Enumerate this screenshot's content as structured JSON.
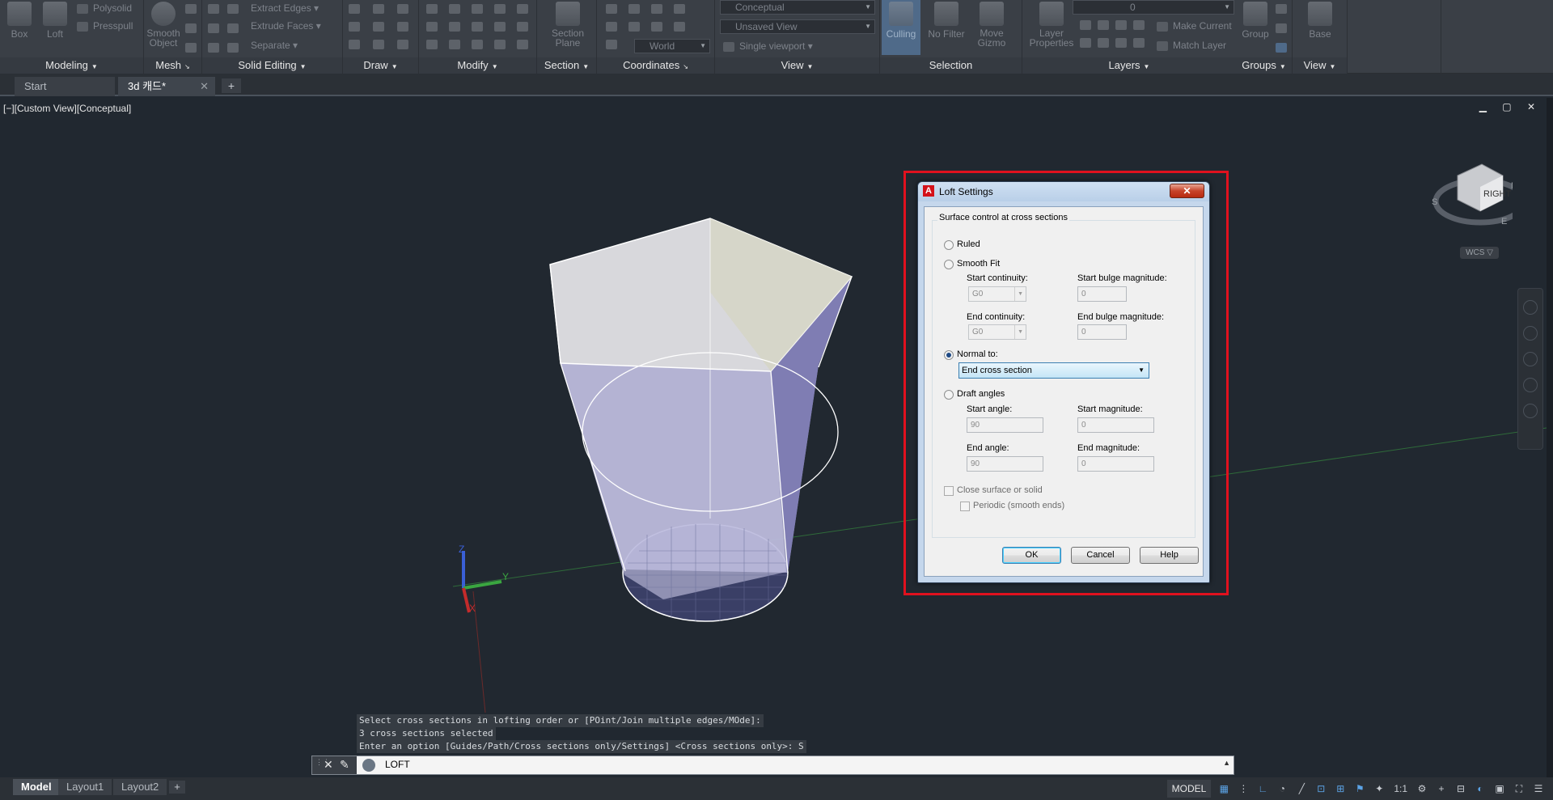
{
  "ribbon": {
    "panels": [
      {
        "key": "modeling",
        "title": "Modeling"
      },
      {
        "key": "mesh",
        "title": "Mesh"
      },
      {
        "key": "solid_editing",
        "title": "Solid Editing"
      },
      {
        "key": "draw",
        "title": "Draw"
      },
      {
        "key": "modify",
        "title": "Modify"
      },
      {
        "key": "section",
        "title": "Section"
      },
      {
        "key": "coordinates",
        "title": "Coordinates"
      },
      {
        "key": "view",
        "title": "View"
      },
      {
        "key": "selection",
        "title": "Selection"
      },
      {
        "key": "layers",
        "title": "Layers"
      },
      {
        "key": "groups",
        "title": "Groups"
      },
      {
        "key": "view2",
        "title": "View"
      }
    ],
    "modeling": {
      "box": "Box",
      "loft": "Loft",
      "polysolid": "Polysolid",
      "presspull": "Presspull"
    },
    "mesh": {
      "smooth_object": "Smooth\nObject"
    },
    "solid_editing": {
      "extract_edges": "Extract Edges",
      "extrude_faces": "Extrude Faces",
      "separate": "Separate"
    },
    "section": {
      "section_plane": "Section\nPlane"
    },
    "coordinates": {
      "world": "World"
    },
    "view": {
      "visual_style": "Conceptual",
      "named_view": "Unsaved View",
      "viewport": "Single viewport"
    },
    "selection": {
      "culling": "Culling",
      "no_filter": "No Filter",
      "move_gizmo": "Move\nGizmo"
    },
    "layers": {
      "layer_properties": "Layer\nProperties",
      "current_layer": "0",
      "make_current": "Make Current",
      "match_layer": "Match Layer"
    },
    "groups": {
      "group": "Group"
    },
    "view2": {
      "base": "Base"
    }
  },
  "tabs": {
    "start": "Start",
    "drawing": "3d 캐드*",
    "close": "✕",
    "add": "+"
  },
  "viewport": {
    "label": "[−][Custom View][Conceptual]",
    "controls": "▁ ▢ ✕",
    "viewcube": {
      "face": "RIGHT",
      "north": "N",
      "south": "S",
      "east": "E",
      "wcs": "WCS ▽"
    },
    "ucs": {
      "x": "X",
      "y": "Y",
      "z": "Z"
    }
  },
  "dialog": {
    "title": "Loft Settings",
    "close": "✕",
    "group_label": "Surface control at cross sections",
    "ruled": "Ruled",
    "smooth_fit": "Smooth Fit",
    "start_continuity": "Start continuity:",
    "start_continuity_value": "G0",
    "start_bulge": "Start bulge magnitude:",
    "start_bulge_value": "0",
    "end_continuity": "End continuity:",
    "end_continuity_value": "G0",
    "end_bulge": "End bulge magnitude:",
    "end_bulge_value": "0",
    "normal_to": "Normal to:",
    "normal_to_value": "End cross section",
    "draft_angles": "Draft angles",
    "start_angle": "Start angle:",
    "start_angle_value": "90",
    "start_magnitude": "Start magnitude:",
    "start_magnitude_value": "0",
    "end_angle": "End angle:",
    "end_angle_value": "90",
    "end_magnitude": "End magnitude:",
    "end_magnitude_value": "0",
    "close_surface": "Close surface or solid",
    "periodic": "Periodic (smooth ends)",
    "ok": "OK",
    "cancel": "Cancel",
    "help": "Help",
    "selected_option": "normal_to"
  },
  "command": {
    "history": [
      "Select cross sections in lofting order or [POint/Join multiple edges/MOde]:",
      " 3 cross sections selected",
      "Enter an option [Guides/Path/Cross sections only/Settings] <Cross sections only>: S"
    ],
    "input": "LOFT"
  },
  "layout_tabs": {
    "model": "Model",
    "layout1": "Layout1",
    "layout2": "Layout2",
    "add": "+"
  },
  "status": {
    "model": "MODEL",
    "scale": "1:1"
  },
  "colors": {
    "highlight": "#e0111e",
    "viewport_bg": "#212830",
    "accent": "#5ba3e6"
  }
}
